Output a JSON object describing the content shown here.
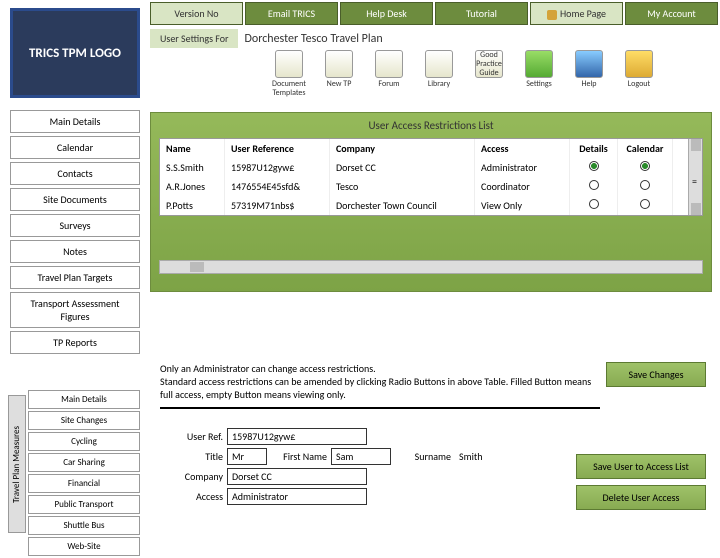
{
  "topnav": {
    "version": "Version No",
    "email": "Email TRICS",
    "help": "Help Desk",
    "tutorial": "Tutorial",
    "home": "Home Page",
    "account": "My Account"
  },
  "logo": "TRICS TPM LOGO",
  "subhead": {
    "usf": "User Settings For",
    "plan": "Dorchester Tesco Travel Plan"
  },
  "iconbar": {
    "doct": "Document Templates",
    "newtp": "New TP",
    "forum": "Forum",
    "library": "Library",
    "gpg": "Good Practice Guide",
    "settings": "Settings",
    "help": "Help",
    "logout": "Logout"
  },
  "sidebar": [
    "Main Details",
    "Calendar",
    "Contacts",
    "Site Documents",
    "Surveys",
    "Notes",
    "Travel Plan Targets",
    "Transport Assessment Figures",
    "TP Reports"
  ],
  "sub_sidebar": [
    "Main Details",
    "Site Changes",
    "Cycling",
    "Car Sharing",
    "Financial",
    "Public Transport",
    "Shuttle Bus",
    "Web-Site"
  ],
  "vtab": "Travel Plan Measures",
  "panel_title": "User Access Restrictions List",
  "tbl": {
    "hdr": {
      "c1": "Name",
      "c2": "User Reference",
      "c3": "Company",
      "c4": "Access",
      "c5": "Details",
      "c6": "Calendar"
    },
    "rows": [
      {
        "c1": "S.S.Smith",
        "c2": "15987U12gyw£",
        "c3": "Dorset CC",
        "c4": "Administrator",
        "d": true,
        "cal": true
      },
      {
        "c1": "A.R.Jones",
        "c2": "1476554E45sfd&",
        "c3": "Tesco",
        "c4": "Coordinator",
        "d": false,
        "cal": false
      },
      {
        "c1": "P.Potts",
        "c2": "57319M71nbs$",
        "c3": "Dorchester Town Council",
        "c4": "View Only",
        "d": false,
        "cal": false
      }
    ]
  },
  "info": {
    "l1": "Only an Administrator can change access restrictions.",
    "l2": "Standard access restrictions can be amended by clicking Radio Buttons in above Table. Filled Button means full access, empty Button means viewing only."
  },
  "btns": {
    "save": "Save Changes",
    "saveuser": "Save User to Access List",
    "deluser": "Delete User Access"
  },
  "form": {
    "userref_l": "User Ref.",
    "userref_v": "15987U12gyw£",
    "title_l": "Title",
    "title_v": "Mr",
    "fname_l": "First Name",
    "fname_v": "Sam",
    "sname_l": "Surname",
    "sname_v": "Smith",
    "company_l": "Company",
    "company_v": "Dorset CC",
    "access_l": "Access",
    "access_v": "Administrator"
  }
}
